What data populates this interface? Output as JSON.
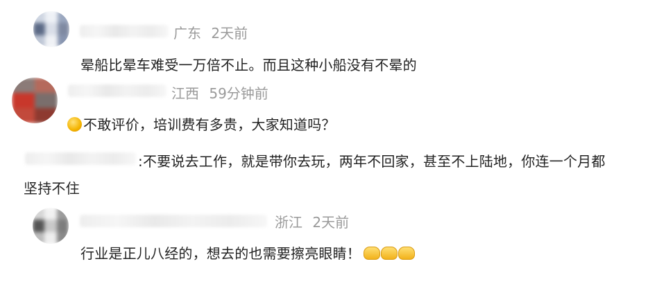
{
  "comments": [
    {
      "location": "广东",
      "time": "2天前",
      "text": "晕船比晕车难受一万倍不止。而且这种小船没有不晕的",
      "avatar_colors": [
        "#cfd6e2",
        "#eef1f6",
        "#9aa7bf",
        "#5c6a86",
        "#d9dee8",
        "#7f8aa2",
        "#bfc7d6",
        "#f0f2f6",
        "#8895b0"
      ]
    },
    {
      "location": "江西",
      "time": "59分钟前",
      "emoji_icon": "cold-sweat-emoji-icon",
      "text": "不敢评价，培训费有多贵，大家知道吗？",
      "avatar_colors": [
        "#8b7b78",
        "#b56a5c",
        "#c8372b",
        "#7a6e6c",
        "#c24a3c",
        "#8e3a30"
      ]
    },
    {
      "reply_separator": ":",
      "text_line1": "不要说去工作，就是带你去玩，两年不回家，甚至不上陆地，你连一个月都",
      "text_line2": "坚持不住"
    },
    {
      "location": "浙江",
      "time": "2天前",
      "text": "行业是正儿八经的，想去的也需要擦亮眼睛！",
      "trailing_icons": [
        "fist-bump-icon",
        "fist-bump-icon",
        "fist-bump-icon"
      ],
      "avatar_colors": [
        "#d6d6d6",
        "#f2f2f2",
        "#9c9c9c",
        "#555555",
        "#c9c9c9",
        "#7d7d7d",
        "#bdbdbd",
        "#eeeeee",
        "#8a8a8a"
      ]
    }
  ]
}
